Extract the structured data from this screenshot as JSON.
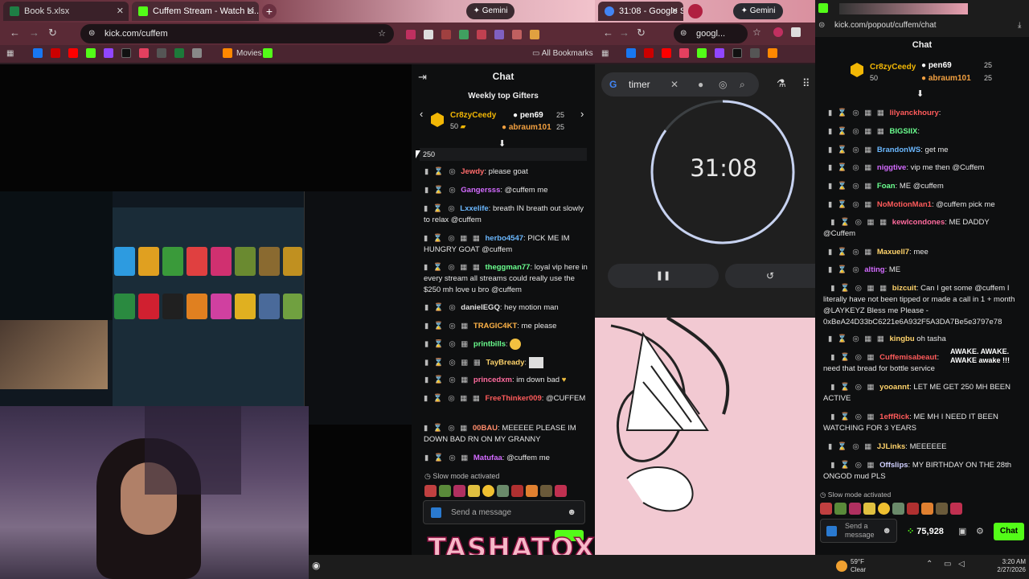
{
  "left_browser": {
    "tabs": [
      {
        "title": "Book 5.xlsx"
      },
      {
        "title": "Cuffem Stream - Watch Li..."
      }
    ],
    "url": "kick.com/cuffem",
    "bookmarks_label": "Movies",
    "all_bookmarks": "All Bookmarks",
    "gemini": "Gemini"
  },
  "kick_chat": {
    "header": "Chat",
    "top_gifters_title": "Weekly top Gifters",
    "gifters": [
      {
        "name": "Cr8zyCeedy",
        "count": "50"
      },
      {
        "name": "pen69",
        "count": "25"
      },
      {
        "name": "abraum101",
        "count": "25"
      }
    ],
    "goal": "250",
    "messages": [
      {
        "user": "Jewdy",
        "text": "please goat",
        "color": "#ff6b6b"
      },
      {
        "user": "Gangersss",
        "text": "@cuffem me",
        "color": "#d36bff"
      },
      {
        "user": "Lxxelife",
        "text": "breath IN breath out slowly to relax @cuffem",
        "color": "#6bb8ff"
      },
      {
        "user": "herbo4547",
        "text": "PICK ME IM HUNGRY GOAT @cuffem",
        "color": "#6bb8ff"
      },
      {
        "user": "theggman77",
        "text": "loyal vip here in every stream all streams could really use the $250 mh love u bro @cuffem",
        "color": "#6bff8f"
      },
      {
        "user": "danielEGQ",
        "text": "hey motion man",
        "color": "#e0e0e0"
      },
      {
        "user": "TRAGIC4KT",
        "text": "me please",
        "color": "#ffb347"
      },
      {
        "user": "printbills",
        "text": "",
        "color": "#6bff8f"
      },
      {
        "user": "TayBready",
        "text": "",
        "color": "#ffd36b"
      },
      {
        "user": "princedxm",
        "text": "im down bad",
        "color": "#ff6b9e"
      },
      {
        "user": "FreeThinker009",
        "text": "@CUFFEM",
        "color": "#ff5b5b"
      },
      {
        "user": "00BAU",
        "text": "MEEEEE PLEASE IM DOWN BAD RN ON MY GRANNY",
        "color": "#ff8c6b"
      },
      {
        "user": "Matufaa",
        "text": "@cuffem me",
        "color": "#d36bff"
      }
    ],
    "slow_mode": "Slow mode activated",
    "send_placeholder": "Send a message",
    "overlay_name": "TASHATOXIC"
  },
  "middle_browser": {
    "tabs": [
      {
        "title": "31:08 - Google S..."
      }
    ],
    "url": "googl...",
    "gemini": "Gemini",
    "search_query": "timer",
    "timer_value": "31:08"
  },
  "popout_chat": {
    "url": "kick.com/popout/cuffem/chat",
    "header": "Chat",
    "gifters": [
      {
        "name": "Cr8zyCeedy",
        "count": "50"
      },
      {
        "name": "pen69",
        "count": "25"
      },
      {
        "name": "abraum101",
        "count": "25"
      }
    ],
    "messages": [
      {
        "user": "lilyanckhoury",
        "text": "",
        "color": "#ff5b5b"
      },
      {
        "user": "BIGSIIX",
        "text": "",
        "color": "#6bff8f"
      },
      {
        "user": "BrandonWS",
        "text": "get me",
        "color": "#6bb8ff"
      },
      {
        "user": "niggtive",
        "text": "vip me then @Cuffem",
        "color": "#d36bff"
      },
      {
        "user": "Foan",
        "text": "ME @cuffem",
        "color": "#6bff8f"
      },
      {
        "user": "NoMotionMan1",
        "text": "@cuffem pick me",
        "color": "#ff5b5b"
      },
      {
        "user": "kewlcondones",
        "text": "ME DADDY @Cuffem",
        "color": "#ff6b9e"
      },
      {
        "user": "Maxuell7",
        "text": "mee",
        "color": "#ffd36b"
      },
      {
        "user": "alting",
        "text": "ME",
        "color": "#d36bff"
      },
      {
        "user": "bizcuit",
        "text": "Can I get some @cuffem I literally have not been tipped or made a call in 1 + month @LAYKEYZ Bless me Please - 0xBeA24D33bC6221e6A932F5A3DA7Be5e3797e78",
        "color": "#ffd36b"
      },
      {
        "user": "kingbu",
        "text": "oh tasha",
        "color": "#ffd36b"
      },
      {
        "user": "Cuffemisabeaut",
        "text": "need that bread for bottle service",
        "color": "#ff5b5b"
      },
      {
        "user": "yooannt",
        "text": "LET ME GET 250 MH BEEN ACTIVE",
        "color": "#ffd36b"
      },
      {
        "user": "1effRick",
        "text": "ME MH I NEED IT BEEN WATCHING FOR 3 YEARS",
        "color": "#ff5b5b"
      },
      {
        "user": "JJLinks",
        "text": "MEEEEEE",
        "color": "#ffd36b"
      },
      {
        "user": "Offslips",
        "text": "MY BIRTHDAY ON THE 28th ONGOD mud PLS",
        "color": "#d0d0ff"
      }
    ],
    "overlay_text": "AWAKE. AWAKE. AWAKE awake !!!",
    "slow_mode": "Slow mode activated",
    "send_placeholder": "Send a message",
    "balance": "75,928",
    "chat_button": "Chat"
  },
  "taskbar": {
    "weather_temp": "59°F",
    "weather_desc": "Clear",
    "time": "3:20 AM",
    "date": "2/27/2026"
  },
  "colors": {
    "kick_green": "#53fc18",
    "chrome_dark": "#2a1c22",
    "accent_gold": "#f2b705"
  }
}
